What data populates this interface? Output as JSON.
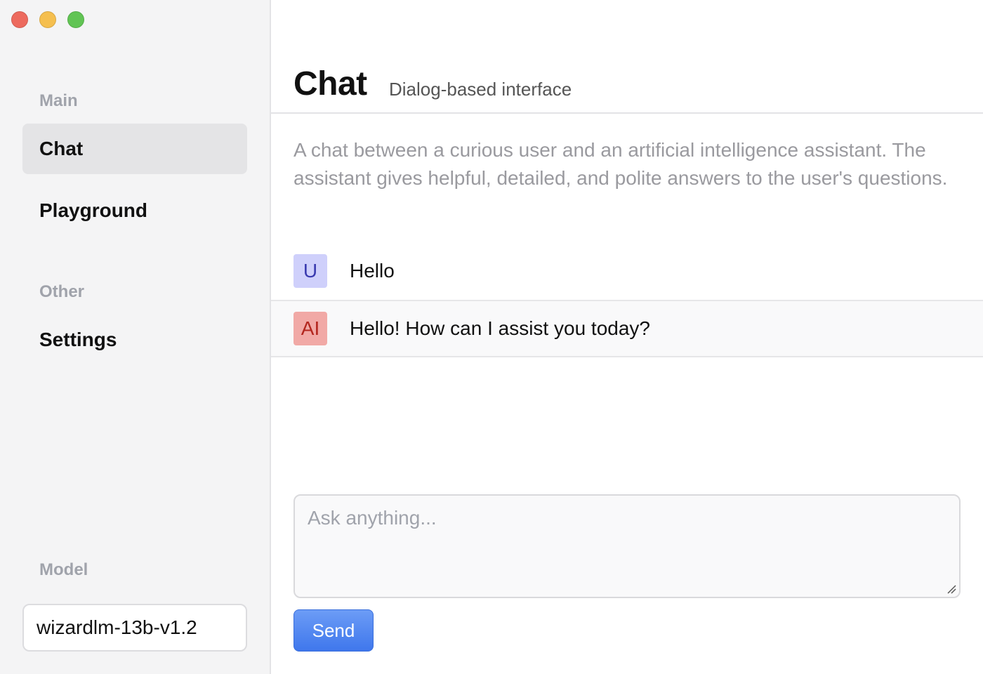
{
  "sidebar": {
    "sections": [
      {
        "title": "Main"
      },
      {
        "title": "Other"
      },
      {
        "title": "Model"
      }
    ],
    "items": [
      {
        "label": "Chat",
        "active": true
      },
      {
        "label": "Playground",
        "active": false
      },
      {
        "label": "Settings",
        "active": false
      }
    ],
    "model": {
      "value": "wizardlm-13b-v1.2"
    }
  },
  "header": {
    "title": "Chat",
    "subtitle": "Dialog-based interface"
  },
  "system_prompt": "A chat between a curious user and an artificial intelligence assistant. The assistant gives helpful, detailed, and polite answers to the user's questions.",
  "messages": [
    {
      "avatar": "U",
      "role": "user",
      "text": "Hello"
    },
    {
      "avatar": "AI",
      "role": "assistant",
      "text": "Hello! How can I assist you today?"
    }
  ],
  "composer": {
    "placeholder": "Ask anything...",
    "send_label": "Send"
  },
  "colors": {
    "sidebar_bg": "#f4f4f5",
    "active_item_bg": "#e4e4e6",
    "user_avatar_bg": "#cfd0fb",
    "ai_avatar_bg": "#f1a9a6",
    "send_button": "#4a84ef"
  },
  "icons": {
    "window_controls": [
      "close-icon",
      "minimize-icon",
      "zoom-icon"
    ],
    "resize_grip": "resize-grip-icon"
  }
}
